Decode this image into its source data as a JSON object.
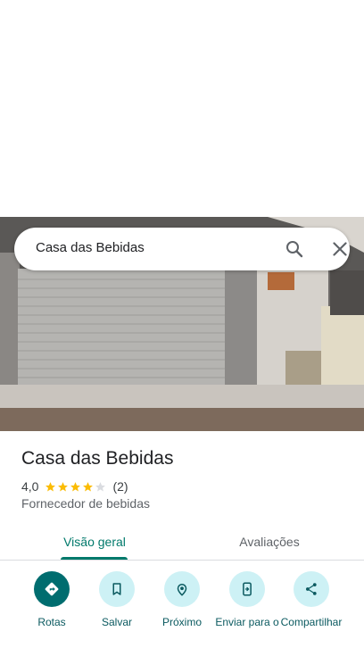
{
  "search": {
    "query": "Casa das Bebidas"
  },
  "place": {
    "title": "Casa das Bebidas",
    "rating": "4,0",
    "stars_filled": 4,
    "stars_total": 5,
    "review_count": "(2)",
    "category": "Fornecedor de bebidas"
  },
  "tabs": [
    {
      "label": "Visão geral",
      "selected": true
    },
    {
      "label": "Avaliações",
      "selected": false
    }
  ],
  "actions": [
    {
      "label": "Rotas",
      "icon": "directions-icon"
    },
    {
      "label": "Salvar",
      "icon": "bookmark-icon"
    },
    {
      "label": "Próximo",
      "icon": "nearby-icon"
    },
    {
      "label": "Enviar para o",
      "icon": "send-to-phone-icon"
    },
    {
      "label": "Compartilhar",
      "icon": "share-icon"
    }
  ],
  "colors": {
    "accent": "#00796b",
    "action_bg": "#cdf1f5",
    "action_primary": "#006d6f",
    "star": "#fbbc04"
  }
}
